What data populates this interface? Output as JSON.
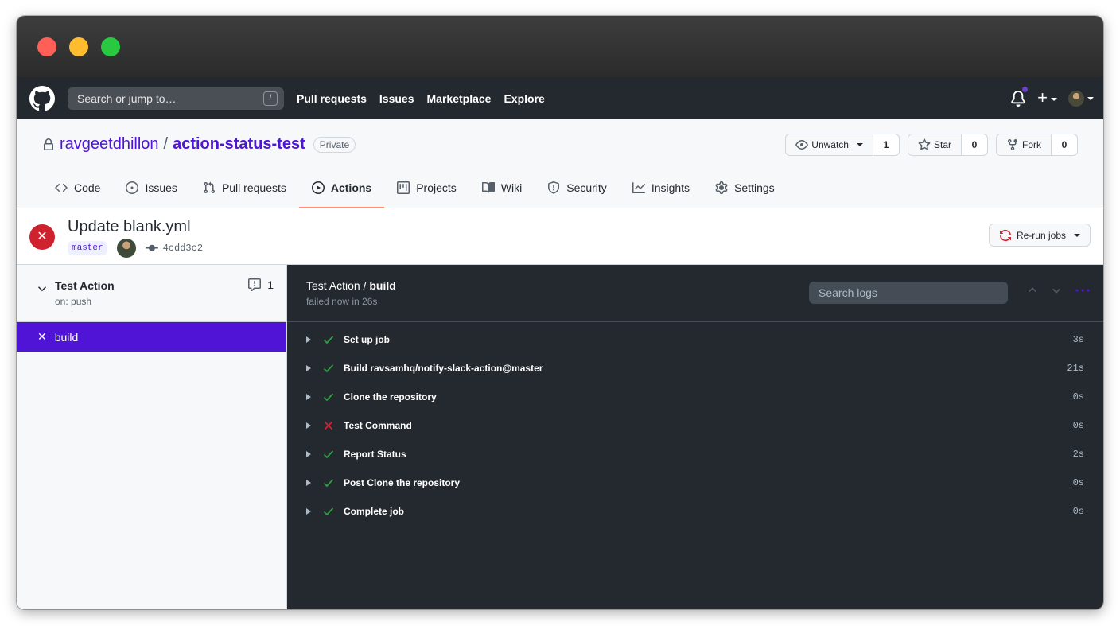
{
  "header": {
    "search_placeholder": "Search or jump to…",
    "search_shortcut": "/",
    "nav": [
      "Pull requests",
      "Issues",
      "Marketplace",
      "Explore"
    ]
  },
  "repo": {
    "owner": "ravgeetdhillon",
    "separator": "/",
    "name": "action-status-test",
    "visibility": "Private",
    "watch_label": "Unwatch",
    "watch_count": "1",
    "star_label": "Star",
    "star_count": "0",
    "fork_label": "Fork",
    "fork_count": "0"
  },
  "tabs": [
    {
      "label": "Code",
      "icon": "code-icon"
    },
    {
      "label": "Issues",
      "icon": "issue-icon"
    },
    {
      "label": "Pull requests",
      "icon": "pull-request-icon"
    },
    {
      "label": "Actions",
      "icon": "play-icon",
      "active": true
    },
    {
      "label": "Projects",
      "icon": "project-icon"
    },
    {
      "label": "Wiki",
      "icon": "book-icon"
    },
    {
      "label": "Security",
      "icon": "shield-icon"
    },
    {
      "label": "Insights",
      "icon": "graph-icon"
    },
    {
      "label": "Settings",
      "icon": "gear-icon"
    }
  ],
  "run": {
    "title": "Update blank.yml",
    "branch": "master",
    "commit": "4cdd3c2",
    "rerun_label": "Re-run jobs"
  },
  "sidebar": {
    "workflow_name": "Test Action",
    "workflow_trigger": "on: push",
    "comment_count": "1",
    "job_name": "build"
  },
  "logs": {
    "workflow": "Test Action /",
    "job": "build",
    "status": "failed now in 26s",
    "search_placeholder": "Search logs",
    "steps": [
      {
        "name": "Set up job",
        "duration": "3s",
        "status": "success"
      },
      {
        "name": "Build ravsamhq/notify-slack-action@master",
        "duration": "21s",
        "status": "success"
      },
      {
        "name": "Clone the repository",
        "duration": "0s",
        "status": "success"
      },
      {
        "name": "Test Command",
        "duration": "0s",
        "status": "failure"
      },
      {
        "name": "Report Status",
        "duration": "2s",
        "status": "success"
      },
      {
        "name": "Post Clone the repository",
        "duration": "0s",
        "status": "success"
      },
      {
        "name": "Complete job",
        "duration": "0s",
        "status": "success"
      }
    ]
  },
  "colors": {
    "accent": "#4f14d6",
    "success": "#2ea043",
    "failure": "#cf222e",
    "header_bg": "#24292f"
  }
}
